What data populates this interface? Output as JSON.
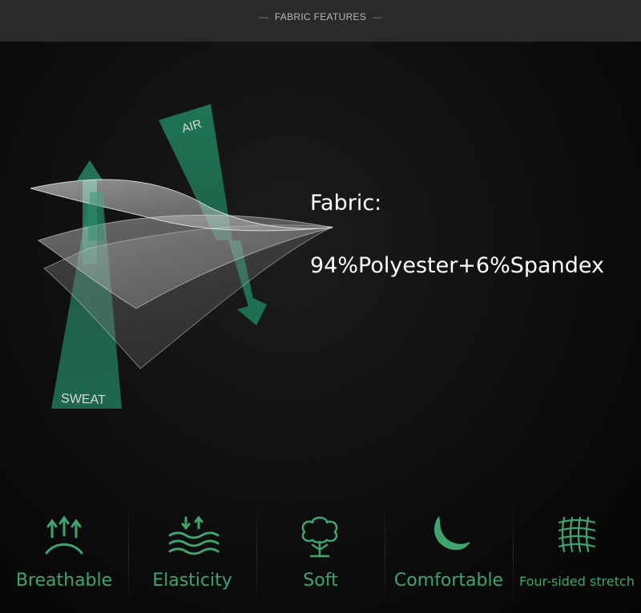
{
  "header": {
    "title": "FABRIC FEATURES",
    "dash": "—"
  },
  "illustration": {
    "air_label": "AIR",
    "sweat_label": "SWEAT"
  },
  "fabric": {
    "label": "Fabric:",
    "composition": "94%Polyester+6%Spandex"
  },
  "features": [
    {
      "label": "Breathable",
      "icon": "breathable-icon"
    },
    {
      "label": "Elasticity",
      "icon": "elasticity-icon"
    },
    {
      "label": "Soft",
      "icon": "soft-cotton-icon"
    },
    {
      "label": "Comfortable",
      "icon": "comfortable-leaf-icon"
    },
    {
      "label": "Four-sided stretch",
      "icon": "four-sided-stretch-icon"
    }
  ],
  "colors": {
    "accent_green": "#3fa46e",
    "dark_green": "#1f6b52",
    "background": "#0e0e0e",
    "header_bar": "#2a2a2a",
    "text": "#ffffff"
  }
}
